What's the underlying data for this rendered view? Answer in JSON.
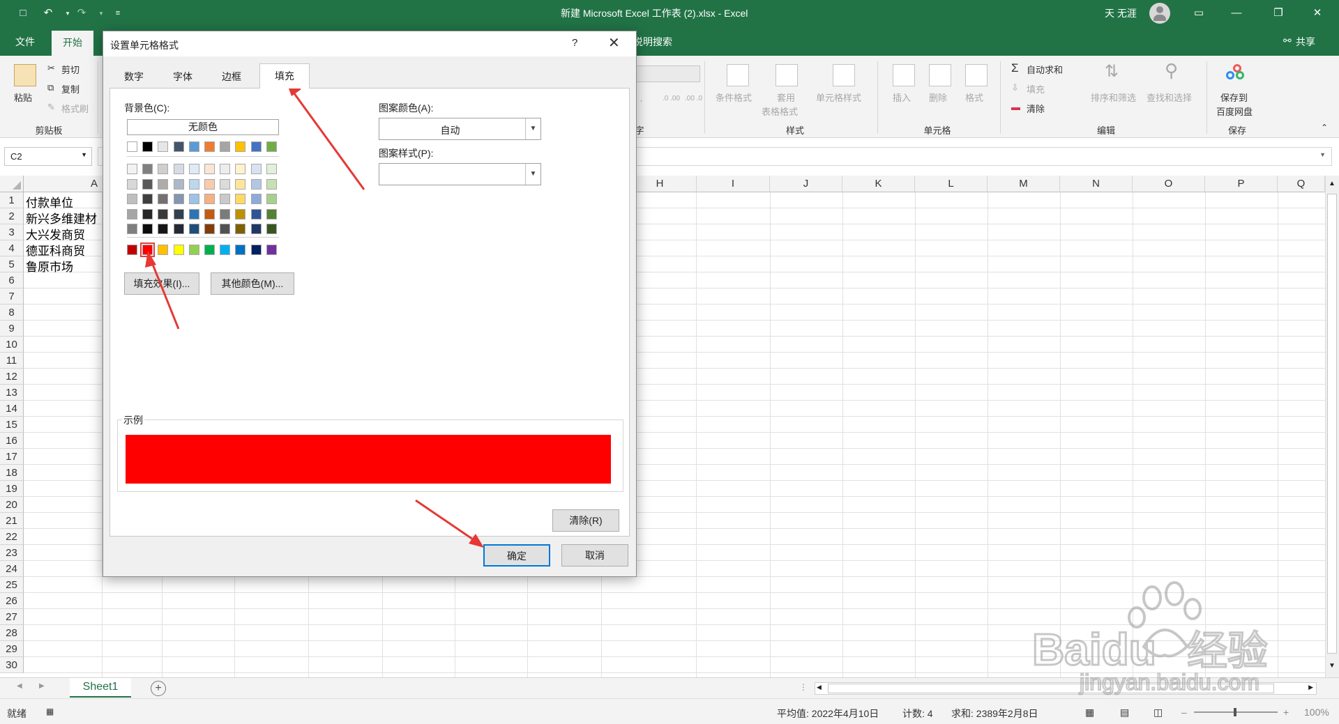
{
  "window": {
    "title": "新建 Microsoft Excel 工作表 (2).xlsx  -  Excel",
    "user": "天 无涯"
  },
  "ribbon_tabs": {
    "file": "文件",
    "home": "开始",
    "search_hint": "说明搜索",
    "share": "共享"
  },
  "ribbon": {
    "clipboard": {
      "paste": "粘贴",
      "cut": "剪切",
      "copy": "复制",
      "format_painter": "格式刷",
      "group": "剪贴板"
    },
    "number_group_fragment": "字",
    "styles": {
      "conditional": "条件格式",
      "table1": "套用",
      "table2": "表格格式",
      "cell_styles": "单元格样式",
      "group": "样式"
    },
    "cells": {
      "insert": "插入",
      "delete": "删除",
      "format": "格式",
      "group": "单元格"
    },
    "editing": {
      "autosum": "自动求和",
      "fill": "填充",
      "clear": "清除",
      "sort": "排序和筛选",
      "find": "查找和选择",
      "group": "编辑"
    },
    "save": {
      "line1": "保存到",
      "line2": "百度网盘",
      "group": "保存"
    }
  },
  "name_box": "C2",
  "grid": {
    "columns": [
      "A",
      "H",
      "I",
      "J",
      "K",
      "L",
      "M",
      "N",
      "O",
      "P",
      "Q"
    ],
    "rows": [
      "1",
      "2",
      "3",
      "4",
      "5",
      "6",
      "7",
      "8",
      "9",
      "10",
      "11",
      "12",
      "13",
      "14",
      "15",
      "16",
      "17",
      "18",
      "19",
      "20",
      "21",
      "22",
      "23",
      "24",
      "25",
      "26",
      "27",
      "28",
      "29",
      "30"
    ],
    "cells_a": [
      "付款单位",
      "新兴多维建材",
      "大兴发商贸",
      "德亚科商贸",
      "鲁原市场"
    ]
  },
  "sheet_tab": "Sheet1",
  "status": {
    "ready": "就绪",
    "average": "平均值: 2022年4月10日",
    "count": "计数: 4",
    "sum": "求和: 2389年2月8日",
    "zoom": "100%"
  },
  "dialog": {
    "title": "设置单元格格式",
    "help": "?",
    "tabs": [
      "数字",
      "字体",
      "边框",
      "填充"
    ],
    "bg_color_label": "背景色(C):",
    "no_color": "无颜色",
    "fill_effects": "填充效果(I)...",
    "more_colors": "其他颜色(M)...",
    "pattern_color_label": "图案颜色(A):",
    "pattern_color_value": "自动",
    "pattern_style_label": "图案样式(P):",
    "sample_label": "示例",
    "clear": "清除(R)",
    "ok": "确定",
    "cancel": "取消",
    "sample_color": "#ff0000",
    "theme_row": [
      "#ffffff",
      "#000000",
      "#e7e6e6",
      "#44546a",
      "#5b9bd5",
      "#ed7d31",
      "#a5a5a5",
      "#ffc000",
      "#4472c4",
      "#70ad47"
    ],
    "shade_rows": [
      [
        "#f2f2f2",
        "#808080",
        "#d0cece",
        "#d6dce4",
        "#deebf6",
        "#fbe5d5",
        "#ededed",
        "#fff2cc",
        "#d9e2f3",
        "#e2efd9"
      ],
      [
        "#d8d8d8",
        "#595959",
        "#aeabab",
        "#adb9ca",
        "#bdd7ee",
        "#f8cbad",
        "#dbdbdb",
        "#fee599",
        "#b4c6e7",
        "#c5e0b3"
      ],
      [
        "#bfbfbf",
        "#3f3f3f",
        "#757070",
        "#8496b0",
        "#9dc3e6",
        "#f4b183",
        "#c9c9c9",
        "#ffd965",
        "#8eaadb",
        "#a8d08d"
      ],
      [
        "#a5a5a5",
        "#262626",
        "#3a3838",
        "#323f4f",
        "#2e75b5",
        "#c55a11",
        "#7b7b7b",
        "#bf9000",
        "#2f5496",
        "#538135"
      ],
      [
        "#7f7f7f",
        "#0c0c0c",
        "#171616",
        "#222a35",
        "#1e4e79",
        "#833c0b",
        "#525252",
        "#7f6000",
        "#1f3864",
        "#375623"
      ]
    ],
    "standard_row": [
      "#c00000",
      "#ff0000",
      "#ffc000",
      "#ffff00",
      "#92d050",
      "#00b050",
      "#00b0f0",
      "#0070c0",
      "#002060",
      "#7030a0"
    ],
    "selected_standard_index": 1
  },
  "watermark": {
    "brand": "Baidu",
    "cn": "经验",
    "url": "jingyan.baidu.com"
  }
}
